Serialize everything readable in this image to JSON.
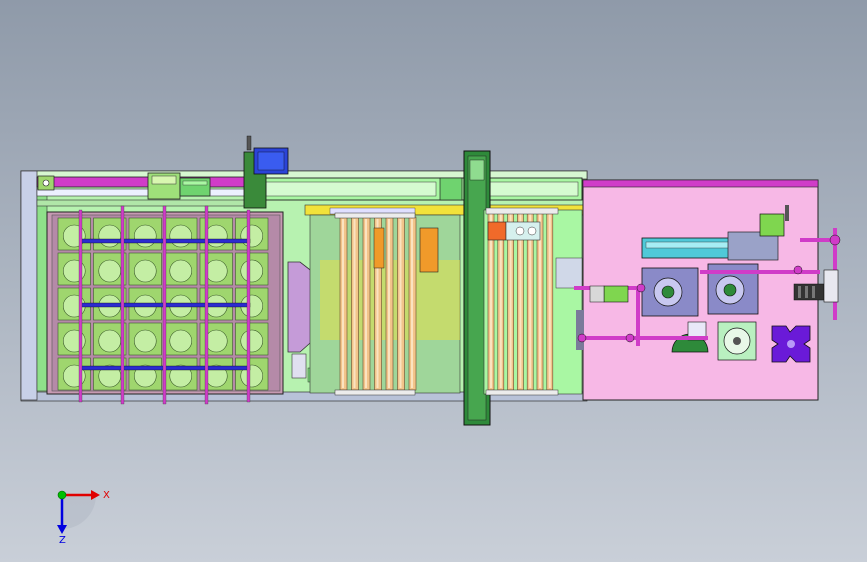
{
  "viewport": {
    "background_top": "#8f9aa9",
    "background_bottom": "#c9cfd8"
  },
  "axes_triad": {
    "x_label": "X",
    "z_label": "Z",
    "x_color": "#e00000",
    "y_color": "#00c000",
    "z_color": "#0000e0"
  },
  "model": {
    "tray_rows": 5,
    "tray_cols": 6,
    "column_count_left": 7,
    "column_count_right": 7,
    "colors": {
      "frame_green": "#a9f7a3",
      "frame_magenta": "#d03cc8",
      "tray_pink": "#c79ab3",
      "tray_cell": "#9fd66e",
      "column_tan": "#f2c48a",
      "module_pink": "#f7b8e6",
      "bar_blue": "#2b2bd0",
      "accent_yellow": "#f2e23a"
    }
  }
}
